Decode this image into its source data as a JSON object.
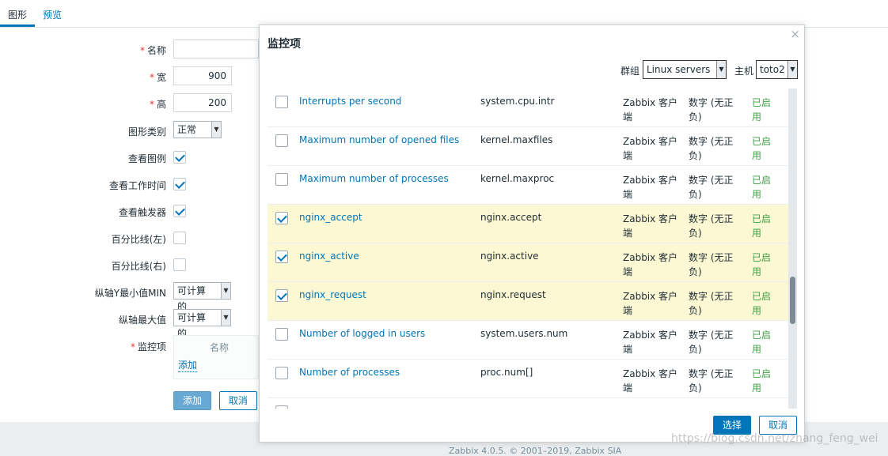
{
  "tabs": [
    {
      "label": "图形",
      "active": true
    },
    {
      "label": "预览",
      "active": false
    }
  ],
  "form": {
    "name_label": "名称",
    "name_value": "",
    "width_label": "宽",
    "width_value": "900",
    "height_label": "高",
    "height_value": "200",
    "graph_type_label": "图形类别",
    "graph_type_value": "正常",
    "show_legend_label": "查看图例",
    "show_working_time_label": "查看工作时间",
    "show_triggers_label": "查看触发器",
    "percentile_left_label": "百分比线(左)",
    "percentile_right_label": "百分比线(右)",
    "ymin_label": "纵轴Y最小值MIN",
    "ymin_value": "可计算的",
    "ymax_label": "纵轴最大值",
    "ymax_value": "可计算的",
    "items_label": "监控项",
    "items_name_header": "名称",
    "items_add_link": "添加",
    "add_button": "添加",
    "cancel_button": "取消",
    "checkboxes": {
      "show_legend": true,
      "show_working_time": true,
      "show_triggers": true,
      "percentile_left": false,
      "percentile_right": false
    }
  },
  "footer": "Zabbix 4.0.5. © 2001–2019, Zabbix SIA",
  "watermark": "https://blog.csdn.net/zhang_feng_wei",
  "modal": {
    "title": "监控项",
    "close_glyph": "×",
    "group_label": "群组",
    "group_value": "Linux servers",
    "host_label": "主机",
    "host_value": "toto2",
    "select_button": "选择",
    "cancel_button": "取消",
    "rows": [
      {
        "name": "Interrupts per second",
        "key": "system.cpu.intr",
        "type": "Zabbix 客户端",
        "value_type": "数字 (无正负)",
        "status": "已启用",
        "checked": false
      },
      {
        "name": "Maximum number of opened files",
        "key": "kernel.maxfiles",
        "type": "Zabbix 客户端",
        "value_type": "数字 (无正负)",
        "status": "已启用",
        "checked": false
      },
      {
        "name": "Maximum number of processes",
        "key": "kernel.maxproc",
        "type": "Zabbix 客户端",
        "value_type": "数字 (无正负)",
        "status": "已启用",
        "checked": false
      },
      {
        "name": "nginx_accept",
        "key": "nginx.accept",
        "type": "Zabbix 客户端",
        "value_type": "数字 (无正负)",
        "status": "已启用",
        "checked": true
      },
      {
        "name": "nginx_active",
        "key": "nginx.active",
        "type": "Zabbix 客户端",
        "value_type": "数字 (无正负)",
        "status": "已启用",
        "checked": true
      },
      {
        "name": "nginx_request",
        "key": "nginx.request",
        "type": "Zabbix 客户端",
        "value_type": "数字 (无正负)",
        "status": "已启用",
        "checked": true
      },
      {
        "name": "Number of logged in users",
        "key": "system.users.num",
        "type": "Zabbix 客户端",
        "value_type": "数字 (无正负)",
        "status": "已启用",
        "checked": false
      },
      {
        "name": "Number of processes",
        "key": "proc.num[]",
        "type": "Zabbix 客户端",
        "value_type": "数字 (无正负)",
        "status": "已启用",
        "checked": false
      },
      {
        "name": "",
        "key": "",
        "type": "",
        "value_type": "",
        "status": "",
        "checked": false
      }
    ]
  }
}
